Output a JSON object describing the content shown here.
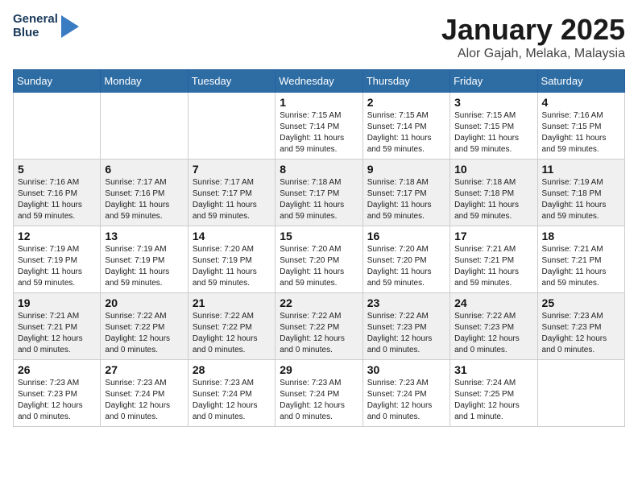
{
  "header": {
    "logo_line1": "General",
    "logo_line2": "Blue",
    "month_year": "January 2025",
    "location": "Alor Gajah, Melaka, Malaysia"
  },
  "days_of_week": [
    "Sunday",
    "Monday",
    "Tuesday",
    "Wednesday",
    "Thursday",
    "Friday",
    "Saturday"
  ],
  "weeks": [
    [
      {
        "day": "",
        "info": ""
      },
      {
        "day": "",
        "info": ""
      },
      {
        "day": "",
        "info": ""
      },
      {
        "day": "1",
        "info": "Sunrise: 7:15 AM\nSunset: 7:14 PM\nDaylight: 11 hours\nand 59 minutes."
      },
      {
        "day": "2",
        "info": "Sunrise: 7:15 AM\nSunset: 7:14 PM\nDaylight: 11 hours\nand 59 minutes."
      },
      {
        "day": "3",
        "info": "Sunrise: 7:15 AM\nSunset: 7:15 PM\nDaylight: 11 hours\nand 59 minutes."
      },
      {
        "day": "4",
        "info": "Sunrise: 7:16 AM\nSunset: 7:15 PM\nDaylight: 11 hours\nand 59 minutes."
      }
    ],
    [
      {
        "day": "5",
        "info": "Sunrise: 7:16 AM\nSunset: 7:16 PM\nDaylight: 11 hours\nand 59 minutes."
      },
      {
        "day": "6",
        "info": "Sunrise: 7:17 AM\nSunset: 7:16 PM\nDaylight: 11 hours\nand 59 minutes."
      },
      {
        "day": "7",
        "info": "Sunrise: 7:17 AM\nSunset: 7:17 PM\nDaylight: 11 hours\nand 59 minutes."
      },
      {
        "day": "8",
        "info": "Sunrise: 7:18 AM\nSunset: 7:17 PM\nDaylight: 11 hours\nand 59 minutes."
      },
      {
        "day": "9",
        "info": "Sunrise: 7:18 AM\nSunset: 7:17 PM\nDaylight: 11 hours\nand 59 minutes."
      },
      {
        "day": "10",
        "info": "Sunrise: 7:18 AM\nSunset: 7:18 PM\nDaylight: 11 hours\nand 59 minutes."
      },
      {
        "day": "11",
        "info": "Sunrise: 7:19 AM\nSunset: 7:18 PM\nDaylight: 11 hours\nand 59 minutes."
      }
    ],
    [
      {
        "day": "12",
        "info": "Sunrise: 7:19 AM\nSunset: 7:19 PM\nDaylight: 11 hours\nand 59 minutes."
      },
      {
        "day": "13",
        "info": "Sunrise: 7:19 AM\nSunset: 7:19 PM\nDaylight: 11 hours\nand 59 minutes."
      },
      {
        "day": "14",
        "info": "Sunrise: 7:20 AM\nSunset: 7:19 PM\nDaylight: 11 hours\nand 59 minutes."
      },
      {
        "day": "15",
        "info": "Sunrise: 7:20 AM\nSunset: 7:20 PM\nDaylight: 11 hours\nand 59 minutes."
      },
      {
        "day": "16",
        "info": "Sunrise: 7:20 AM\nSunset: 7:20 PM\nDaylight: 11 hours\nand 59 minutes."
      },
      {
        "day": "17",
        "info": "Sunrise: 7:21 AM\nSunset: 7:21 PM\nDaylight: 11 hours\nand 59 minutes."
      },
      {
        "day": "18",
        "info": "Sunrise: 7:21 AM\nSunset: 7:21 PM\nDaylight: 11 hours\nand 59 minutes."
      }
    ],
    [
      {
        "day": "19",
        "info": "Sunrise: 7:21 AM\nSunset: 7:21 PM\nDaylight: 12 hours\nand 0 minutes."
      },
      {
        "day": "20",
        "info": "Sunrise: 7:22 AM\nSunset: 7:22 PM\nDaylight: 12 hours\nand 0 minutes."
      },
      {
        "day": "21",
        "info": "Sunrise: 7:22 AM\nSunset: 7:22 PM\nDaylight: 12 hours\nand 0 minutes."
      },
      {
        "day": "22",
        "info": "Sunrise: 7:22 AM\nSunset: 7:22 PM\nDaylight: 12 hours\nand 0 minutes."
      },
      {
        "day": "23",
        "info": "Sunrise: 7:22 AM\nSunset: 7:23 PM\nDaylight: 12 hours\nand 0 minutes."
      },
      {
        "day": "24",
        "info": "Sunrise: 7:22 AM\nSunset: 7:23 PM\nDaylight: 12 hours\nand 0 minutes."
      },
      {
        "day": "25",
        "info": "Sunrise: 7:23 AM\nSunset: 7:23 PM\nDaylight: 12 hours\nand 0 minutes."
      }
    ],
    [
      {
        "day": "26",
        "info": "Sunrise: 7:23 AM\nSunset: 7:23 PM\nDaylight: 12 hours\nand 0 minutes."
      },
      {
        "day": "27",
        "info": "Sunrise: 7:23 AM\nSunset: 7:24 PM\nDaylight: 12 hours\nand 0 minutes."
      },
      {
        "day": "28",
        "info": "Sunrise: 7:23 AM\nSunset: 7:24 PM\nDaylight: 12 hours\nand 0 minutes."
      },
      {
        "day": "29",
        "info": "Sunrise: 7:23 AM\nSunset: 7:24 PM\nDaylight: 12 hours\nand 0 minutes."
      },
      {
        "day": "30",
        "info": "Sunrise: 7:23 AM\nSunset: 7:24 PM\nDaylight: 12 hours\nand 0 minutes."
      },
      {
        "day": "31",
        "info": "Sunrise: 7:24 AM\nSunset: 7:25 PM\nDaylight: 12 hours\nand 1 minute."
      },
      {
        "day": "",
        "info": ""
      }
    ]
  ]
}
